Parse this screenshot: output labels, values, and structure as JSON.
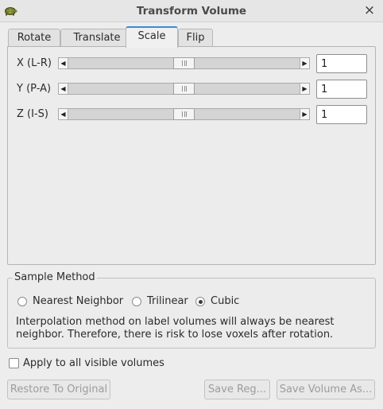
{
  "window": {
    "title": "Transform Volume",
    "close_glyph": "×"
  },
  "tabs": [
    {
      "label": "Rotate",
      "active": false
    },
    {
      "label": "Translate",
      "active": false
    },
    {
      "label": "Scale",
      "active": true
    },
    {
      "label": "Flip",
      "active": false
    }
  ],
  "scale": {
    "rows": [
      {
        "label": "X (L-R)",
        "value": "1"
      },
      {
        "label": "Y (P-A)",
        "value": "1"
      },
      {
        "label": "Z (I-S)",
        "value": "1"
      }
    ],
    "slider_left_glyph": "◀",
    "slider_right_glyph": "▶"
  },
  "sample_method": {
    "title": "Sample Method",
    "options": [
      {
        "label": "Nearest Neighbor",
        "checked": false
      },
      {
        "label": "Trilinear",
        "checked": false
      },
      {
        "label": "Cubic",
        "checked": true
      }
    ],
    "note": "Interpolation method on label volumes will always be nearest neighbor. Therefore, there is risk to lose voxels after rotation."
  },
  "apply_all": {
    "label": "Apply to all visible volumes",
    "checked": false
  },
  "buttons": {
    "restore": "Restore To Original",
    "save_reg": "Save Reg...",
    "save_volume": "Save Volume As..."
  },
  "colors": {
    "window_bg": "#ededed",
    "active_tab_accent": "#3c8ad6",
    "disabled_text": "#9c9c9c"
  },
  "icons": {
    "app": "turtle-icon",
    "close": "close-icon"
  }
}
